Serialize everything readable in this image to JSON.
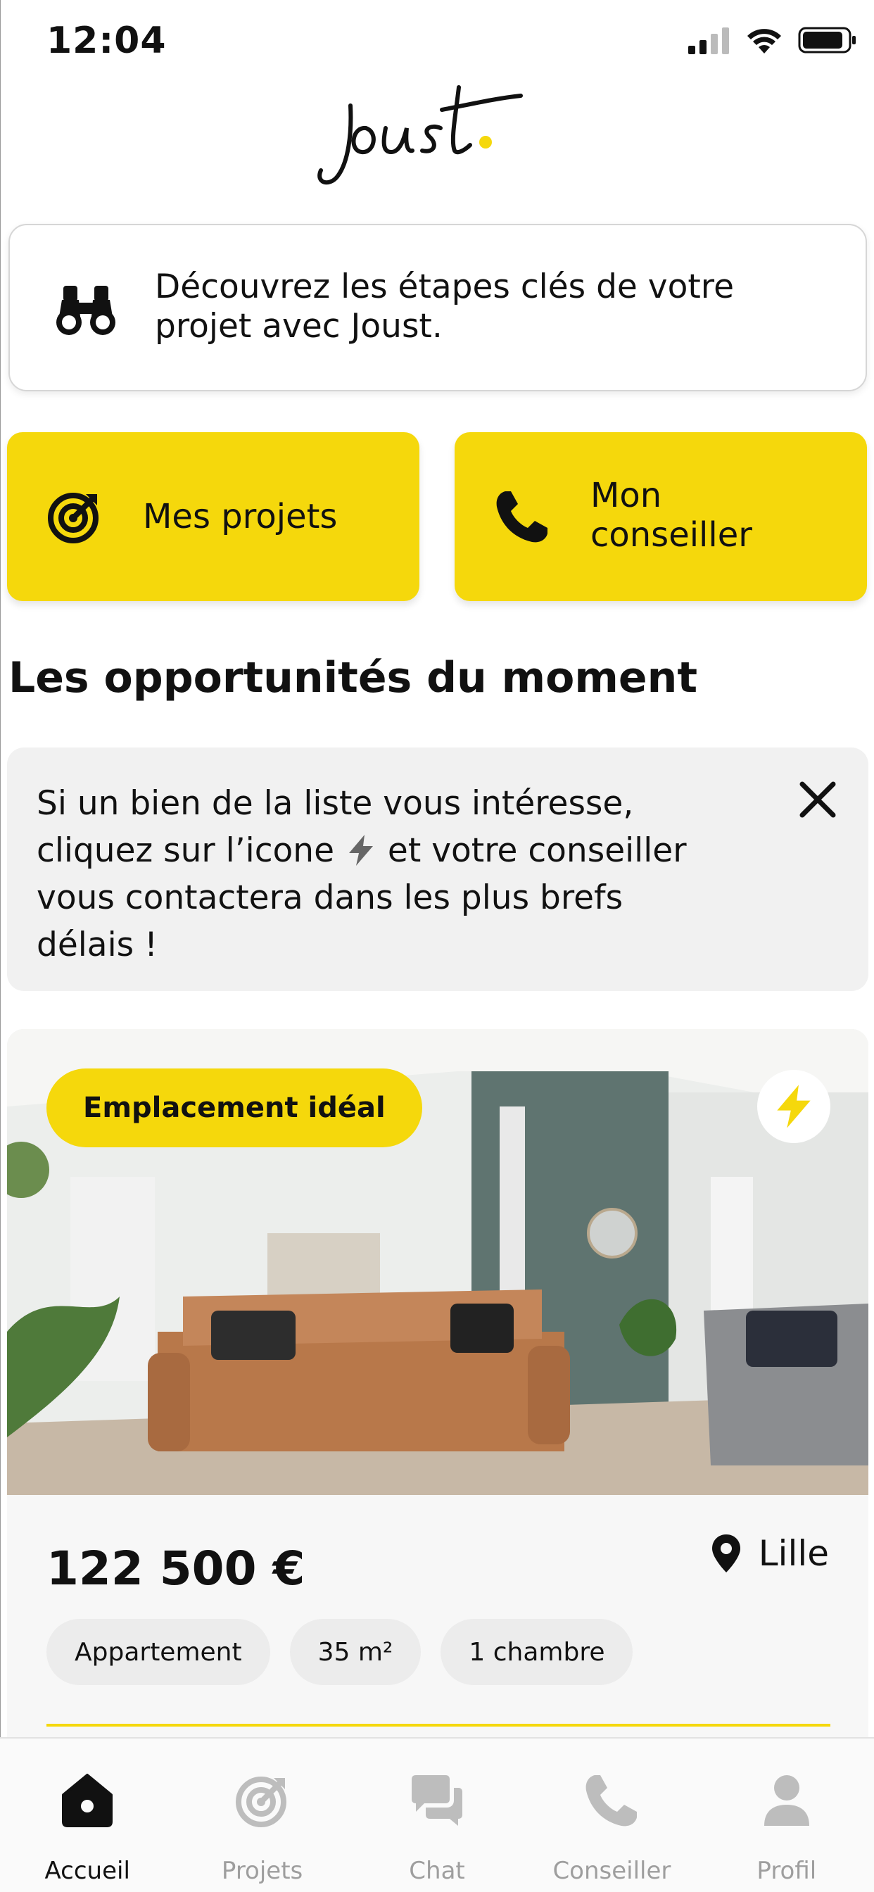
{
  "status_bar": {
    "time": "12:04"
  },
  "logo": {
    "text": "joust",
    "accent_color": "#f5d80c"
  },
  "discover": {
    "icon": "binoculars-icon",
    "text": "Découvrez les étapes clés de votre projet avec Joust."
  },
  "quick_actions": [
    {
      "icon": "target-icon",
      "label_lines": [
        "Mes projets"
      ]
    },
    {
      "icon": "phone-icon",
      "label_lines": [
        "Mon",
        "conseiller"
      ]
    }
  ],
  "section_title": "Les opportunités du moment",
  "info_banner": {
    "text_before": "Si un bien de la liste vous intéresse, cliquez sur l’icone",
    "text_after": "et votre conseiller vous contactera dans les plus brefs délais !"
  },
  "property": {
    "tag": "Emplacement idéal",
    "price": "122 500 €",
    "location": "Lille",
    "chips": [
      "Appartement",
      "35 m²",
      "1 chambre"
    ]
  },
  "tabs": [
    {
      "label": "Accueil",
      "icon": "home-icon",
      "active": true
    },
    {
      "label": "Projets",
      "icon": "target-icon",
      "active": false
    },
    {
      "label": "Chat",
      "icon": "chat-icon",
      "active": false
    },
    {
      "label": "Conseiller",
      "icon": "phone-icon",
      "active": false
    },
    {
      "label": "Profil",
      "icon": "user-icon",
      "active": false
    }
  ],
  "colors": {
    "brand_yellow": "#f5d80c",
    "text": "#111111",
    "inactive": "#9e9e9e"
  }
}
